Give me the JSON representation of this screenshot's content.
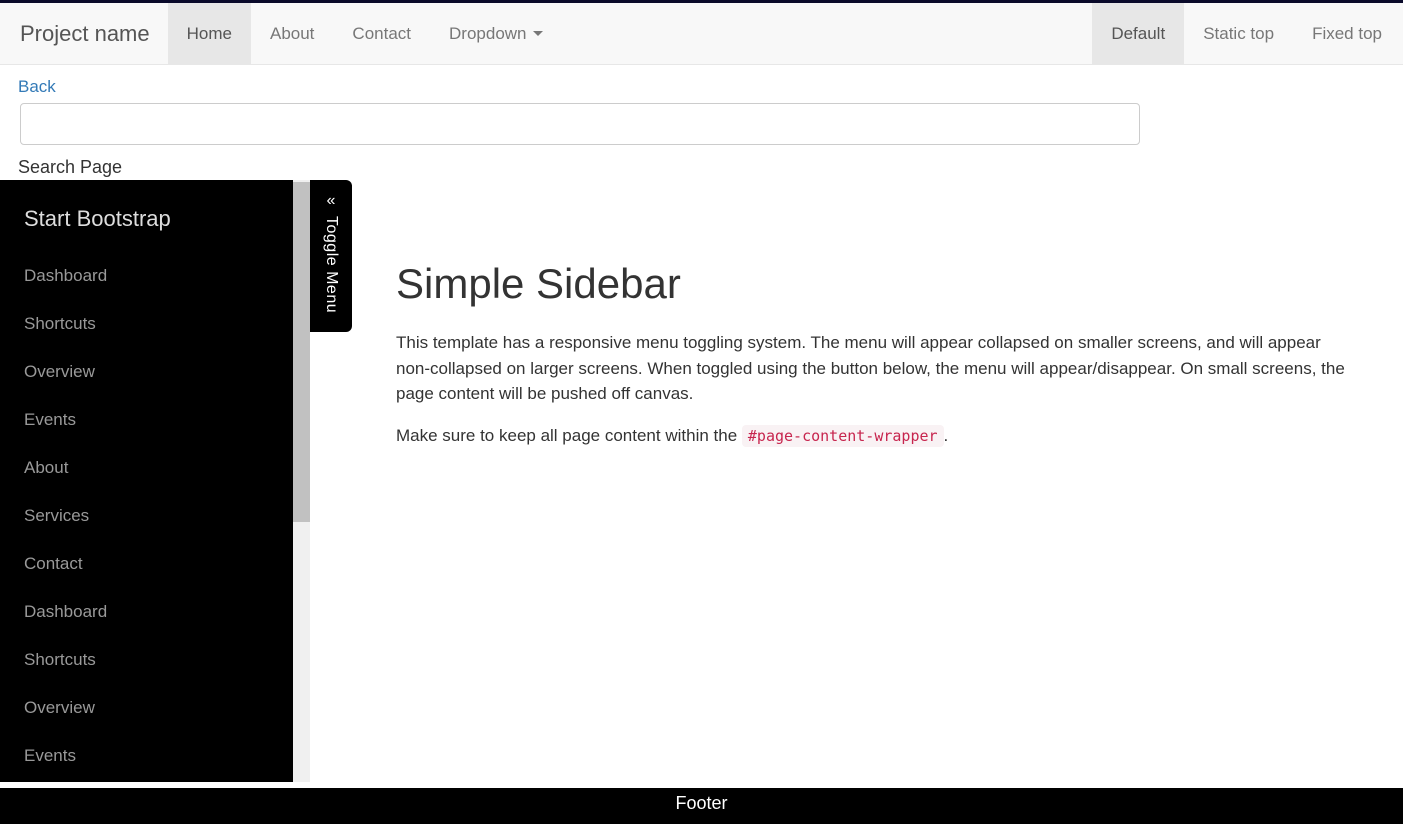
{
  "navbar": {
    "brand": "Project name",
    "left": [
      {
        "label": "Home",
        "active": true
      },
      {
        "label": "About",
        "active": false
      },
      {
        "label": "Contact",
        "active": false
      },
      {
        "label": "Dropdown",
        "active": false,
        "dropdown": true
      }
    ],
    "right": [
      {
        "label": "Default",
        "active": true
      },
      {
        "label": "Static top",
        "active": false
      },
      {
        "label": "Fixed top",
        "active": false
      }
    ]
  },
  "back": {
    "label": "Back"
  },
  "search": {
    "label": "Search Page",
    "value": ""
  },
  "sidebar": {
    "brand": "Start Bootstrap",
    "items": [
      {
        "label": "Dashboard"
      },
      {
        "label": "Shortcuts"
      },
      {
        "label": "Overview"
      },
      {
        "label": "Events"
      },
      {
        "label": "About"
      },
      {
        "label": "Services"
      },
      {
        "label": "Contact"
      },
      {
        "label": "Dashboard"
      },
      {
        "label": "Shortcuts"
      },
      {
        "label": "Overview"
      },
      {
        "label": "Events"
      }
    ]
  },
  "toggle": {
    "label": "Toggle Menu"
  },
  "content": {
    "title": "Simple Sidebar",
    "p1": "This template has a responsive menu toggling system. The menu will appear collapsed on smaller screens, and will appear non-collapsed on larger screens. When toggled using the button below, the menu will appear/disappear. On small screens, the page content will be pushed off canvas.",
    "p2_prefix": "Make sure to keep all page content within the ",
    "p2_code": "#page-content-wrapper",
    "p2_suffix": "."
  },
  "footer": {
    "label": "Footer"
  }
}
